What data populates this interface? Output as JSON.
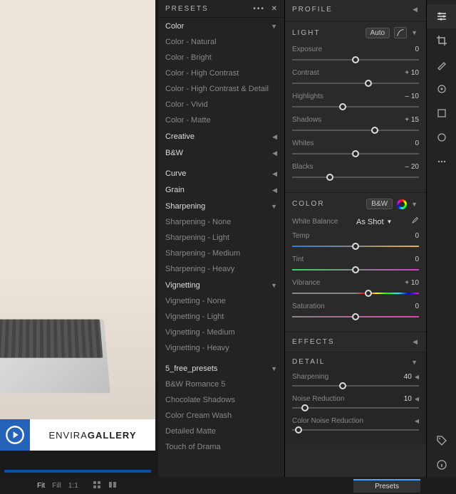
{
  "presets": {
    "title": "PRESETS",
    "groups": [
      {
        "name": "Color",
        "expanded": true,
        "items": [
          "Color - Natural",
          "Color - Bright",
          "Color - High Contrast",
          "Color - High Contrast & Detail",
          "Color - Vivid",
          "Color - Matte"
        ]
      },
      {
        "name": "Creative",
        "expanded": false,
        "items": []
      },
      {
        "name": "B&W",
        "expanded": false,
        "items": []
      }
    ],
    "groups2": [
      {
        "name": "Curve",
        "expanded": false,
        "items": []
      },
      {
        "name": "Grain",
        "expanded": false,
        "items": []
      },
      {
        "name": "Sharpening",
        "expanded": true,
        "items": [
          "Sharpening - None",
          "Sharpening - Light",
          "Sharpening - Medium",
          "Sharpening - Heavy"
        ]
      },
      {
        "name": "Vignetting",
        "expanded": true,
        "items": [
          "Vignetting - None",
          "Vignetting - Light",
          "Vignetting - Medium",
          "Vignetting - Heavy"
        ]
      }
    ],
    "groups3": [
      {
        "name": "5_free_presets",
        "expanded": true,
        "items": [
          "B&W Romance 5",
          "Chocolate Shadows",
          "Color Cream Wash",
          "Detailed Matte",
          "Touch of Drama"
        ]
      }
    ]
  },
  "edit": {
    "profile_title": "PROFILE",
    "light": {
      "title": "LIGHT",
      "auto": "Auto",
      "sliders": {
        "exposure": {
          "label": "Exposure",
          "value": "0",
          "pos": 50
        },
        "contrast": {
          "label": "Contrast",
          "value": "+ 10",
          "pos": 60
        },
        "highlights": {
          "label": "Highlights",
          "value": "– 10",
          "pos": 40
        },
        "shadows": {
          "label": "Shadows",
          "value": "+ 15",
          "pos": 65
        },
        "whites": {
          "label": "Whites",
          "value": "0",
          "pos": 50
        },
        "blacks": {
          "label": "Blacks",
          "value": "– 20",
          "pos": 30
        }
      }
    },
    "color": {
      "title": "COLOR",
      "bw": "B&W",
      "wb_label": "White Balance",
      "wb_value": "As Shot",
      "sliders": {
        "temp": {
          "label": "Temp",
          "value": "0",
          "pos": 50
        },
        "tint": {
          "label": "Tint",
          "value": "0",
          "pos": 50
        },
        "vibrance": {
          "label": "Vibrance",
          "value": "+ 10",
          "pos": 60
        },
        "saturation": {
          "label": "Saturation",
          "value": "0",
          "pos": 50
        }
      }
    },
    "effects_title": "EFFECTS",
    "detail": {
      "title": "DETAIL",
      "sharpening": {
        "label": "Sharpening",
        "value": "40",
        "pos": 40
      },
      "noise": {
        "label": "Noise Reduction",
        "value": "10",
        "pos": 10
      },
      "colornoise": {
        "label": "Color Noise Reduction",
        "value": "",
        "pos": 5
      }
    }
  },
  "bottom": {
    "fit": "Fit",
    "fill": "Fill",
    "oneone": "1:1",
    "presets_btn": "Presets"
  },
  "logo": {
    "a": "ENVIRA",
    "b": "GALLERY"
  }
}
